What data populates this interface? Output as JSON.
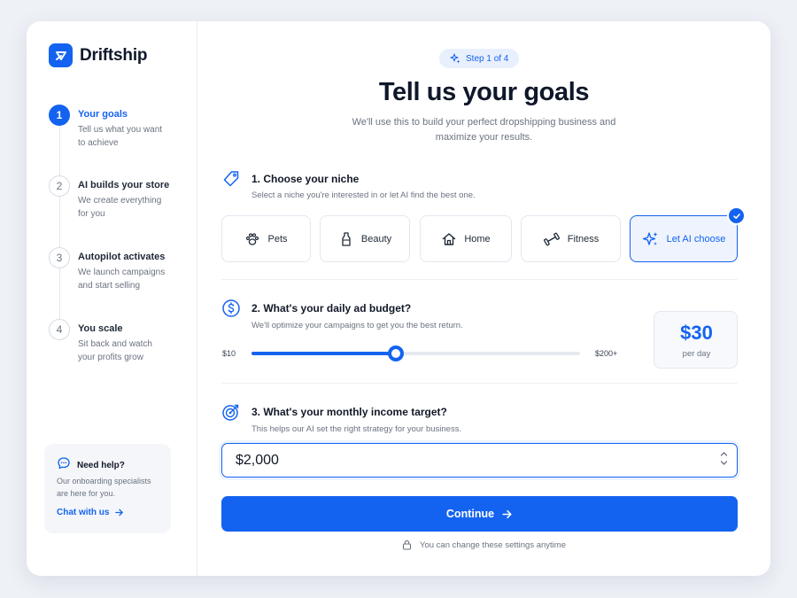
{
  "brand": {
    "name": "Driftship"
  },
  "sidebar": {
    "steps": [
      {
        "number": "1",
        "title": "Your goals",
        "desc": "Tell us what you want to achieve",
        "active": true
      },
      {
        "number": "2",
        "title": "AI builds your store",
        "desc": "We create everything for you",
        "active": false
      },
      {
        "number": "3",
        "title": "Autopilot activates",
        "desc": "We launch campaigns and start selling",
        "active": false
      },
      {
        "number": "4",
        "title": "You scale",
        "desc": "Sit back and watch your profits grow",
        "active": false
      }
    ],
    "help": {
      "title": "Need help?",
      "desc": "Our onboarding specialists are here for you.",
      "link": "Chat with us"
    }
  },
  "main": {
    "step_pill": "Step 1 of 4",
    "headline": "Tell us your goals",
    "subline": "We'll use this to build your perfect dropshipping business and maximize your results.",
    "niche": {
      "title": "1.  Choose your niche",
      "sub": "Select a niche you're interested in or let AI find the best one.",
      "options": [
        {
          "label": "Pets",
          "icon": "paw-icon"
        },
        {
          "label": "Beauty",
          "icon": "bottle-icon"
        },
        {
          "label": "Home",
          "icon": "house-icon"
        },
        {
          "label": "Fitness",
          "icon": "dumbbell-icon"
        },
        {
          "label": "Let AI choose",
          "icon": "sparkles-icon",
          "selected": true
        }
      ]
    },
    "budget": {
      "title": "2.  What's your daily ad budget?",
      "sub": "We'll optimize your campaigns to get you the best return.",
      "min_label": "$10",
      "max_label": "$200+",
      "min": 10,
      "max": 200,
      "value": 30,
      "fill_fraction": 0.44,
      "value_display": "$30",
      "unit": "per day"
    },
    "income": {
      "title": "3.  What's your monthly income target?",
      "sub": "This helps our AI set the right strategy for your business.",
      "value": "$2,000"
    },
    "continue_label": "Continue",
    "footnote": "You can change these settings anytime"
  },
  "colors": {
    "accent": "#1463f0",
    "text": "#0f172a",
    "muted": "#6b7280"
  }
}
